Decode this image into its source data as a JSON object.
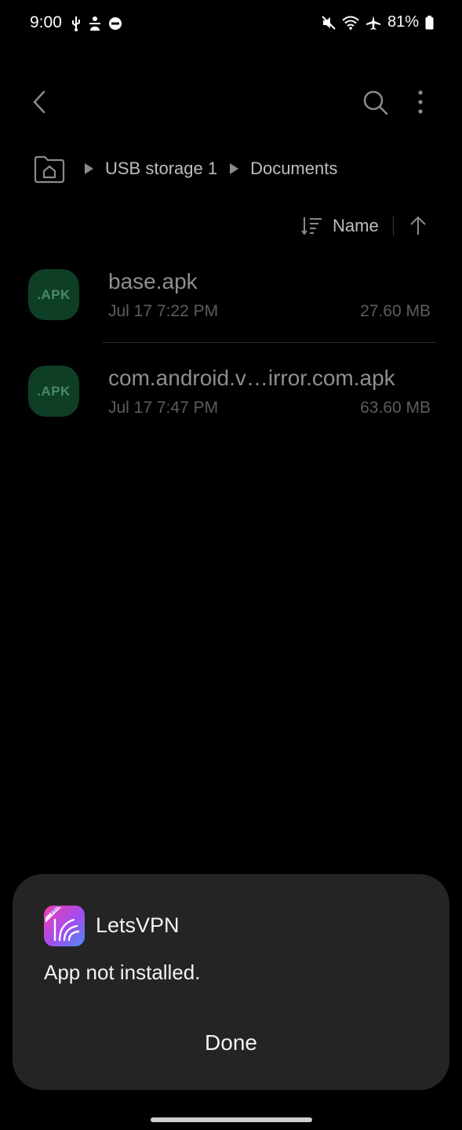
{
  "status_bar": {
    "time": "9:00",
    "battery_percent": "81%",
    "left_icons": [
      "usb-icon",
      "accessibility-icon",
      "do-not-disturb-icon"
    ],
    "right_icons": [
      "mute-icon",
      "wifi-icon",
      "airplane-icon",
      "battery-icon"
    ]
  },
  "toolbar": {
    "back_icon": "chevron-left-icon",
    "search_icon": "search-icon",
    "more_icon": "more-vertical-icon"
  },
  "breadcrumb": {
    "home_icon": "home-folder-icon",
    "items": [
      {
        "label": "USB storage 1"
      },
      {
        "label": "Documents"
      }
    ]
  },
  "sort": {
    "label": "Name",
    "direction": "ascending"
  },
  "files": [
    {
      "icon_text": ".APK",
      "name": "base.apk",
      "date": "Jul 17 7:22 PM",
      "size": "27.60 MB"
    },
    {
      "icon_text": ".APK",
      "name": "com.android.v…irror.com.apk",
      "date": "Jul 17 7:47 PM",
      "size": "63.60 MB"
    }
  ],
  "dialog": {
    "app_name": "LetsVPN",
    "app_icon_badge": "PRO",
    "message": "App not installed.",
    "done_label": "Done"
  },
  "colors": {
    "background": "#000000",
    "dialog_background": "#242424",
    "apk_icon_background": "#0e3f26"
  }
}
